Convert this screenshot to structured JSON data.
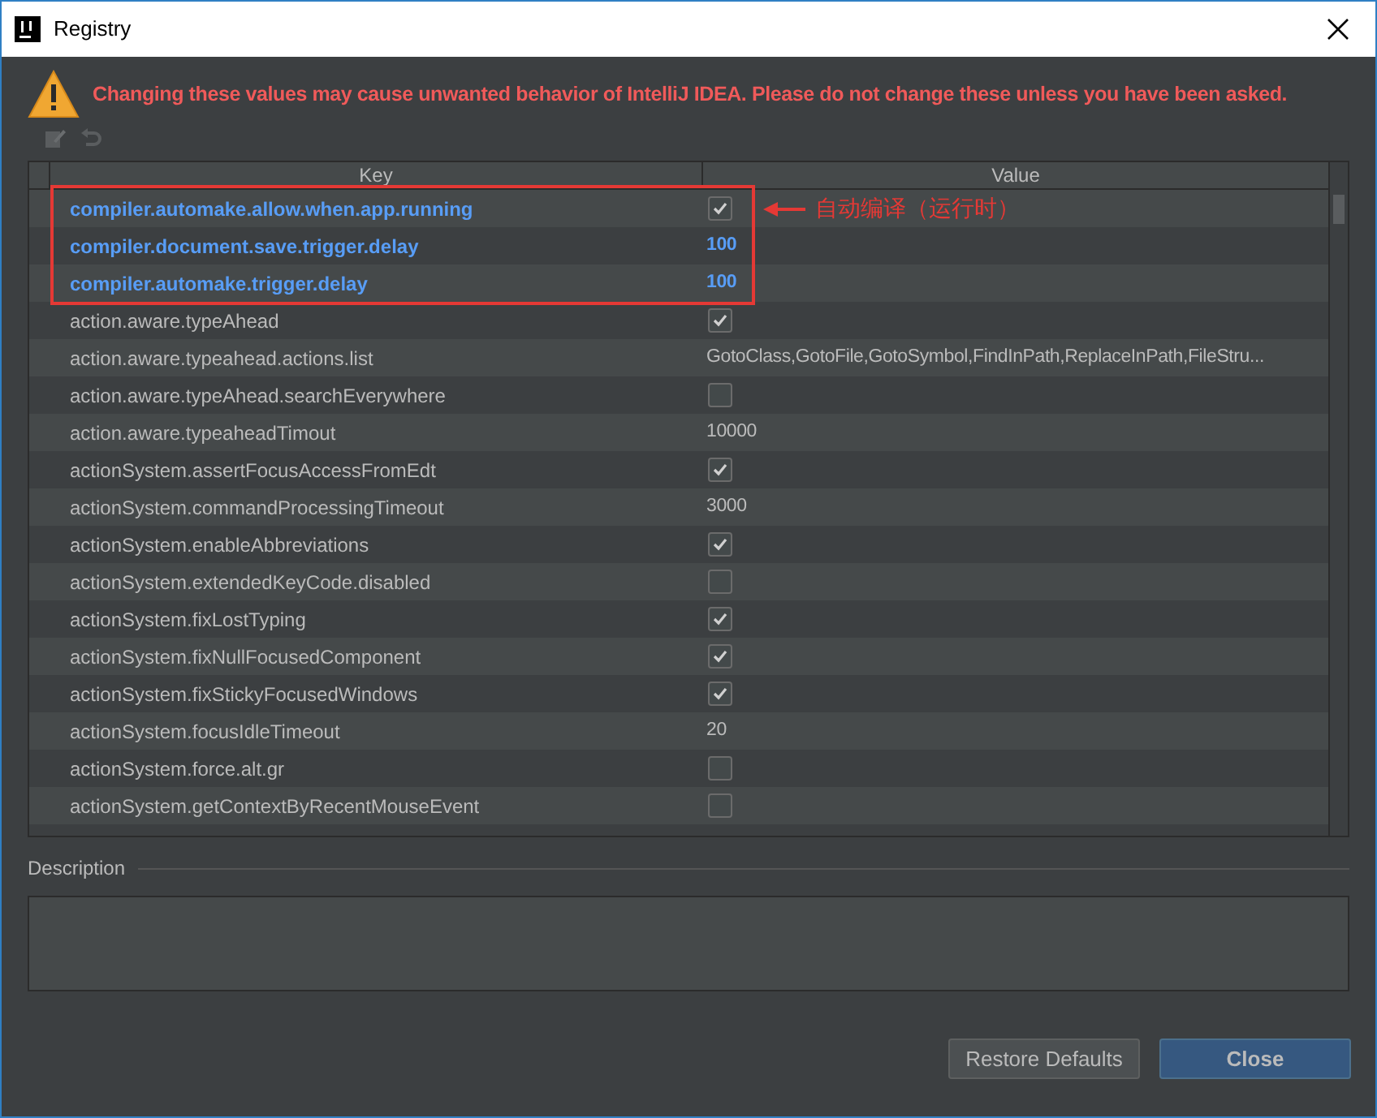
{
  "window": {
    "title": "Registry"
  },
  "warning": "Changing these values may cause unwanted behavior of IntelliJ IDEA. Please do not change these unless you have been asked.",
  "table": {
    "columns": [
      "Key",
      "Value"
    ],
    "rows": [
      {
        "key": "compiler.automake.allow.when.app.running",
        "kind": "checkbox",
        "checked": true,
        "modified": true
      },
      {
        "key": "compiler.document.save.trigger.delay",
        "kind": "text",
        "value": "100",
        "modified": true
      },
      {
        "key": "compiler.automake.trigger.delay",
        "kind": "text",
        "value": "100",
        "modified": true
      },
      {
        "key": "action.aware.typeAhead",
        "kind": "checkbox",
        "checked": true,
        "modified": false
      },
      {
        "key": "action.aware.typeahead.actions.list",
        "kind": "text",
        "value": "GotoClass,GotoFile,GotoSymbol,FindInPath,ReplaceInPath,FileStru...",
        "modified": false
      },
      {
        "key": "action.aware.typeAhead.searchEverywhere",
        "kind": "checkbox",
        "checked": false,
        "modified": false
      },
      {
        "key": "action.aware.typeaheadTimout",
        "kind": "text",
        "value": "10000",
        "modified": false
      },
      {
        "key": "actionSystem.assertFocusAccessFromEdt",
        "kind": "checkbox",
        "checked": true,
        "modified": false
      },
      {
        "key": "actionSystem.commandProcessingTimeout",
        "kind": "text",
        "value": "3000",
        "modified": false
      },
      {
        "key": "actionSystem.enableAbbreviations",
        "kind": "checkbox",
        "checked": true,
        "modified": false
      },
      {
        "key": "actionSystem.extendedKeyCode.disabled",
        "kind": "checkbox",
        "checked": false,
        "modified": false
      },
      {
        "key": "actionSystem.fixLostTyping",
        "kind": "checkbox",
        "checked": true,
        "modified": false
      },
      {
        "key": "actionSystem.fixNullFocusedComponent",
        "kind": "checkbox",
        "checked": true,
        "modified": false
      },
      {
        "key": "actionSystem.fixStickyFocusedWindows",
        "kind": "checkbox",
        "checked": true,
        "modified": false
      },
      {
        "key": "actionSystem.focusIdleTimeout",
        "kind": "text",
        "value": "20",
        "modified": false
      },
      {
        "key": "actionSystem.force.alt.gr",
        "kind": "checkbox",
        "checked": false,
        "modified": false
      },
      {
        "key": "actionSystem.getContextByRecentMouseEvent",
        "kind": "checkbox",
        "checked": false,
        "modified": false
      }
    ]
  },
  "annotation": "自动编译（运行时）",
  "description": {
    "label": "Description"
  },
  "buttons": [
    {
      "label": "Restore Defaults",
      "primary": false
    },
    {
      "label": "Close",
      "primary": true
    }
  ]
}
